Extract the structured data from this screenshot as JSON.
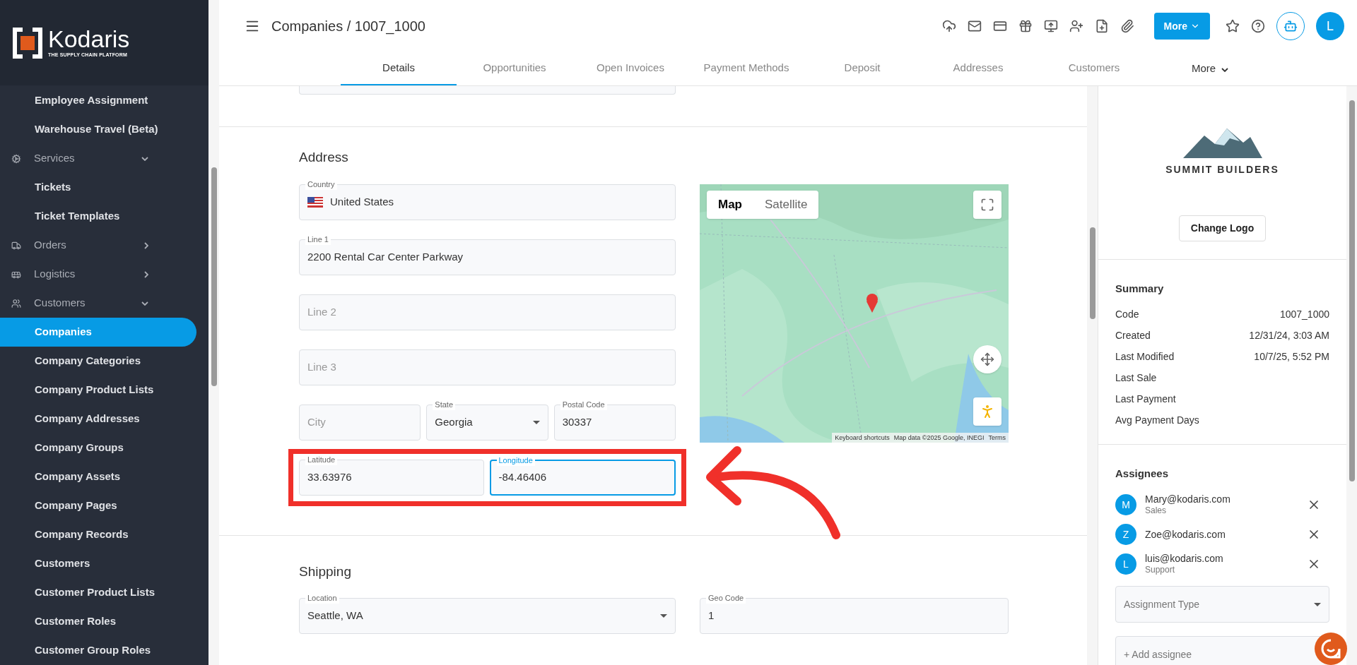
{
  "sidebar": {
    "logo": {
      "name": "Kodaris",
      "tagline": "THE SUPPLY CHAIN PLATFORM"
    },
    "items": [
      {
        "kind": "link",
        "label": "Employee Assignment",
        "selected": false
      },
      {
        "kind": "link",
        "label": "Warehouse Travel (Beta)",
        "selected": false
      },
      {
        "kind": "section",
        "label": "Services",
        "expanded": true
      },
      {
        "kind": "link",
        "label": "Tickets",
        "selected": false
      },
      {
        "kind": "link",
        "label": "Ticket Templates",
        "selected": false
      },
      {
        "kind": "section",
        "label": "Orders",
        "expanded": false
      },
      {
        "kind": "section",
        "label": "Logistics",
        "expanded": false
      },
      {
        "kind": "section",
        "label": "Customers",
        "expanded": true
      },
      {
        "kind": "link",
        "label": "Companies",
        "selected": true
      },
      {
        "kind": "link",
        "label": "Company Categories",
        "selected": false
      },
      {
        "kind": "link",
        "label": "Company Product Lists",
        "selected": false
      },
      {
        "kind": "link",
        "label": "Company Addresses",
        "selected": false
      },
      {
        "kind": "link",
        "label": "Company Groups",
        "selected": false
      },
      {
        "kind": "link",
        "label": "Company Assets",
        "selected": false
      },
      {
        "kind": "link",
        "label": "Company Pages",
        "selected": false
      },
      {
        "kind": "link",
        "label": "Company Records",
        "selected": false
      },
      {
        "kind": "link",
        "label": "Customers",
        "selected": false
      },
      {
        "kind": "link",
        "label": "Customer Product Lists",
        "selected": false
      },
      {
        "kind": "link",
        "label": "Customer Roles",
        "selected": false
      },
      {
        "kind": "link",
        "label": "Customer Group Roles",
        "selected": false
      }
    ]
  },
  "header": {
    "title": "Companies / 1007_1000",
    "more_button": "More",
    "avatar": "L",
    "tabs": [
      {
        "label": "Details",
        "selected": true
      },
      {
        "label": "Opportunities",
        "selected": false
      },
      {
        "label": "Open Invoices",
        "selected": false
      },
      {
        "label": "Payment Methods",
        "selected": false
      },
      {
        "label": "Deposit",
        "selected": false
      },
      {
        "label": "Addresses",
        "selected": false
      },
      {
        "label": "Customers",
        "selected": false
      }
    ],
    "tabs_more": "More"
  },
  "address": {
    "heading": "Address",
    "rows": [
      [
        {
          "kind": "country",
          "label": "Country",
          "value": "United States",
          "focused": false
        }
      ],
      [
        {
          "kind": "text",
          "label": "Line 1",
          "value": "2200 Rental Car Center Parkway",
          "focused": false
        }
      ],
      [
        {
          "kind": "text",
          "placeholder": "Line 2",
          "focused": false
        }
      ],
      [
        {
          "kind": "text",
          "placeholder": "Line 3",
          "focused": false
        }
      ],
      [
        {
          "kind": "text",
          "placeholder": "City",
          "focused": false
        },
        {
          "kind": "select",
          "label": "State",
          "value": "Georgia",
          "focused": false
        },
        {
          "kind": "text",
          "label": "Postal Code",
          "value": "30337",
          "focused": false
        }
      ],
      [
        {
          "kind": "text",
          "label": "Latitude",
          "value": "33.63976",
          "focused": false
        },
        {
          "kind": "text",
          "label": "Longitude",
          "value": "-84.46406",
          "focused": true
        }
      ]
    ],
    "map": {
      "modes": [
        {
          "label": "Map",
          "selected": true
        },
        {
          "label": "Satellite",
          "selected": false
        }
      ],
      "attribution": [
        "Keyboard shortcuts",
        "Map data ©2025 Google, INEGI",
        "Terms"
      ]
    }
  },
  "shipping": {
    "heading": "Shipping",
    "fields": [
      {
        "kind": "select",
        "label": "Location",
        "value": "Seattle, WA"
      },
      {
        "kind": "text",
        "label": "Geo Code",
        "value": "1"
      }
    ]
  },
  "panel": {
    "logo_text": "SUMMIT BUILDERS",
    "change_logo": "Change Logo",
    "summary": {
      "heading": "Summary",
      "rows": [
        {
          "label": "Code",
          "value": "1007_1000"
        },
        {
          "label": "Created",
          "value": "12/31/24, 3:03 AM"
        },
        {
          "label": "Last Modified",
          "value": "10/7/25, 5:52 PM"
        },
        {
          "label": "Last Sale"
        },
        {
          "label": "Last Payment"
        },
        {
          "label": "Avg Payment Days"
        }
      ]
    },
    "assignees": {
      "heading": "Assignees",
      "people": [
        {
          "initial": "M",
          "email": "Mary@kodaris.com",
          "role": "Sales"
        },
        {
          "initial": "Z",
          "email": "Zoe@kodaris.com"
        },
        {
          "initial": "L",
          "email": "luis@kodaris.com",
          "role": "Support"
        }
      ],
      "type_placeholder": "Assignment Type",
      "add_placeholder": "+ Add assignee"
    }
  }
}
